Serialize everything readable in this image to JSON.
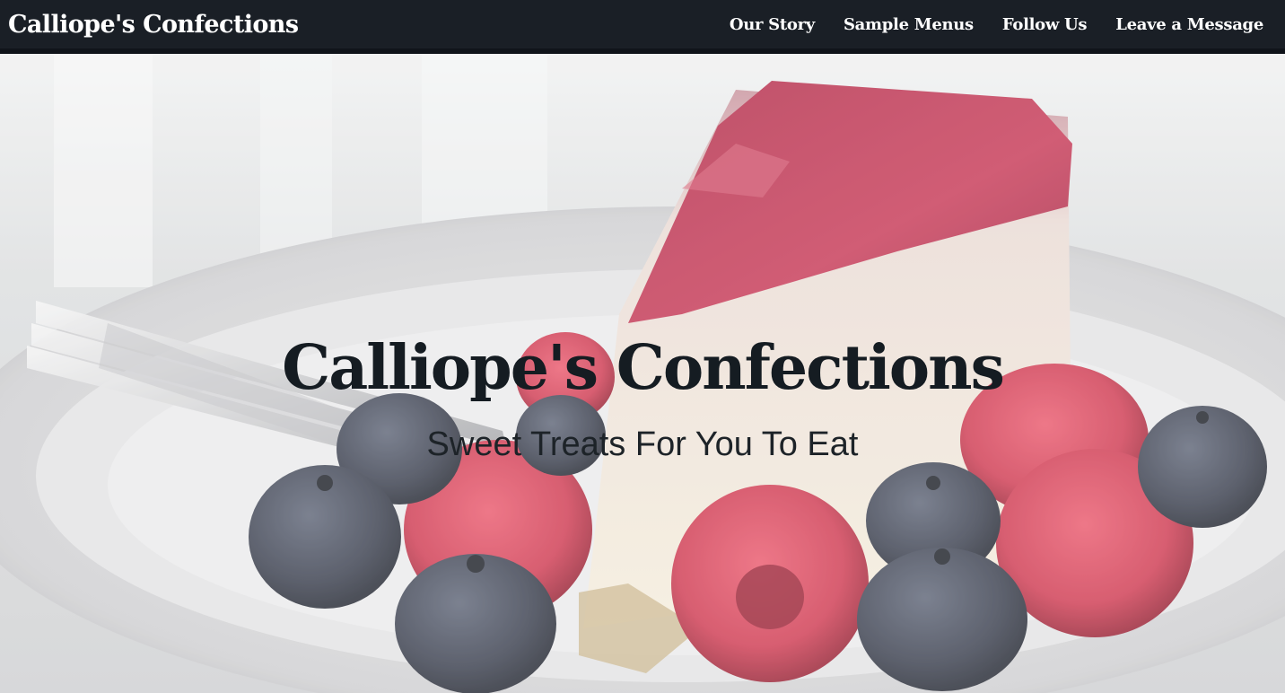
{
  "navbar": {
    "brand": "Calliope's Confections",
    "links": [
      {
        "label": "Our Story"
      },
      {
        "label": "Sample Menus"
      },
      {
        "label": "Follow Us"
      },
      {
        "label": "Leave a Message"
      }
    ]
  },
  "hero": {
    "title": "Calliope's Confections",
    "subtitle": "Sweet Treats For You To Eat",
    "image": "cheesecake-with-berries-photo"
  },
  "colors": {
    "navbar_bg": "#1a1f26",
    "nav_text": "#ffffff",
    "hero_title": "#151c22",
    "hero_subtitle": "#1d2328"
  }
}
